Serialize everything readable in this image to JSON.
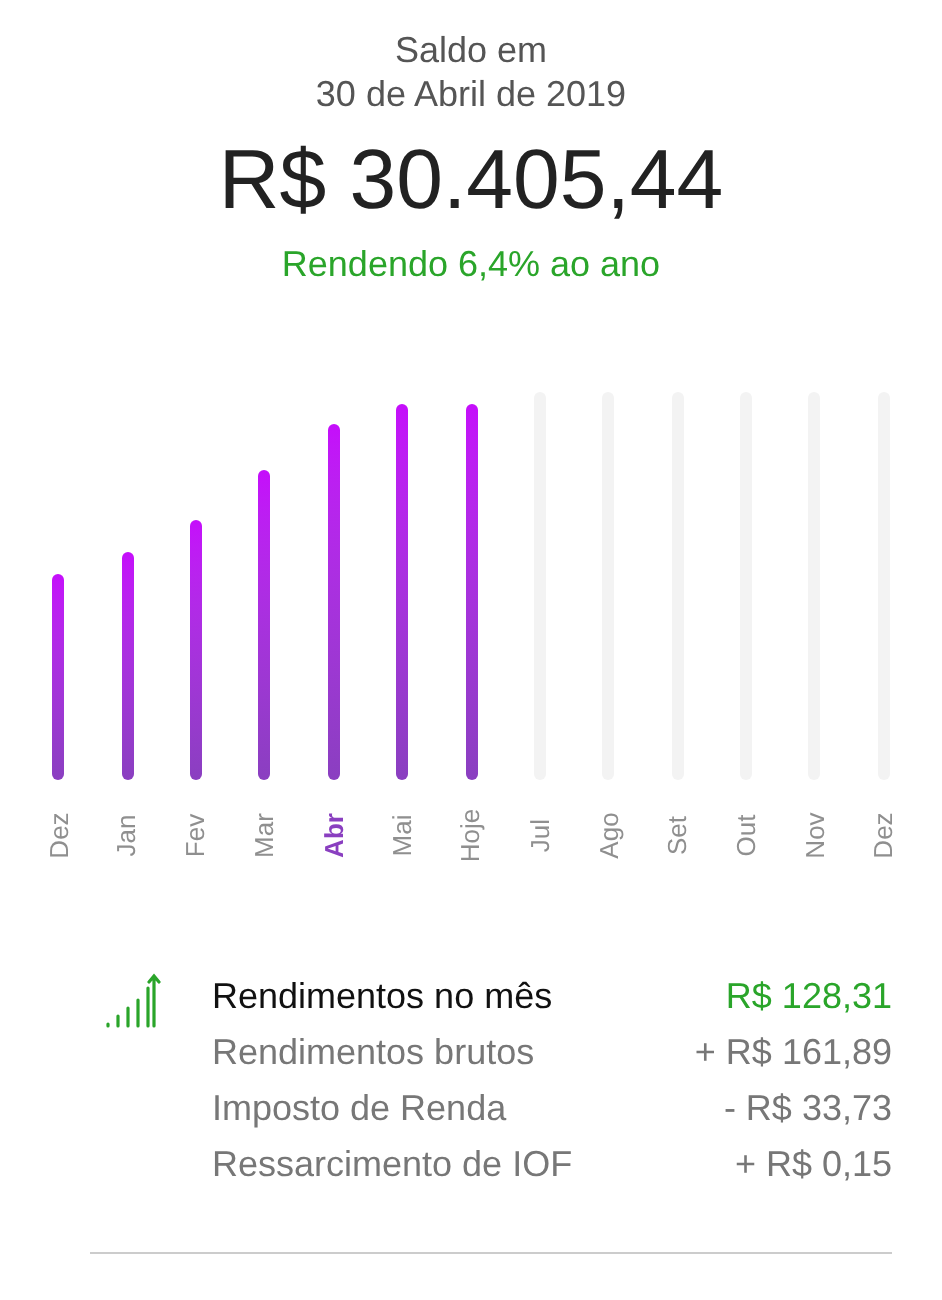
{
  "header": {
    "label": "Saldo em",
    "date": "30 de Abril de 2019",
    "balance": "R$ 30.405,44",
    "yield": "Rendendo 6,4% ao ano"
  },
  "months": [
    {
      "label": "Dez",
      "selected": false,
      "filled": true
    },
    {
      "label": "Jan",
      "selected": false,
      "filled": true
    },
    {
      "label": "Fev",
      "selected": false,
      "filled": true
    },
    {
      "label": "Mar",
      "selected": false,
      "filled": true
    },
    {
      "label": "Abr",
      "selected": true,
      "filled": true
    },
    {
      "label": "Mai",
      "selected": false,
      "filled": true
    },
    {
      "label": "Hoje",
      "selected": false,
      "filled": true
    },
    {
      "label": "Jul",
      "selected": false,
      "filled": false
    },
    {
      "label": "Ago",
      "selected": false,
      "filled": false
    },
    {
      "label": "Set",
      "selected": false,
      "filled": false
    },
    {
      "label": "Out",
      "selected": false,
      "filled": false
    },
    {
      "label": "Nov",
      "selected": false,
      "filled": false
    },
    {
      "label": "Dez",
      "selected": false,
      "filled": false
    }
  ],
  "summary": [
    {
      "kind": "total",
      "label": "Rendimentos no mês",
      "value": "R$ 128,31"
    },
    {
      "kind": "detail",
      "label": "Rendimentos brutos",
      "value": "+ R$ 161,89"
    },
    {
      "kind": "detail",
      "label": "Imposto de Renda",
      "value": "- R$ 33,73"
    },
    {
      "kind": "detail",
      "label": "Ressarcimento de IOF",
      "value": "+ R$ 0,15"
    }
  ]
}
